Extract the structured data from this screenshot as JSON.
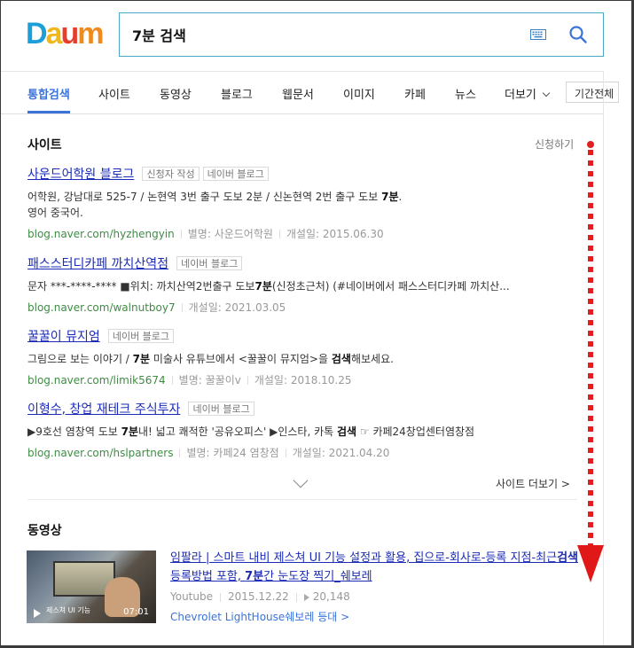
{
  "logo": {
    "text": "Daum",
    "letters": [
      "D",
      "a",
      "u",
      "m"
    ],
    "colors": [
      "#1c9fd8",
      "#f0b71b",
      "#e53e2c",
      "#f08a1c"
    ]
  },
  "search": {
    "query": "7분 검색"
  },
  "tabs": [
    {
      "label": "통합검색",
      "active": true
    },
    {
      "label": "사이트"
    },
    {
      "label": "동영상"
    },
    {
      "label": "블로그"
    },
    {
      "label": "웹문서"
    },
    {
      "label": "이미지"
    },
    {
      "label": "카페"
    },
    {
      "label": "뉴스"
    },
    {
      "label": "더보기"
    }
  ],
  "period_filter": "기간전체",
  "site_section": {
    "title": "사이트",
    "apply_link": "신청하기",
    "results": [
      {
        "title": "사운드어학원 블로그",
        "tags": [
          "신청자 작성",
          "네이버 블로그"
        ],
        "desc_line1": "어학원, 강남대로 525-7 / 논현역 3번 출구 도보 2분 / 신논현역 2번 출구 도보 ",
        "desc_line1_bold": "7분",
        "desc_line1_end": ".",
        "desc_line2": "영어 중국어.",
        "url": "blog.naver.com/hyzhengyin",
        "meta": [
          "별명: 사운드어학원",
          "개설일: 2015.06.30"
        ]
      },
      {
        "title": "패스스터디카페 까치산역점",
        "tags": [
          "네이버 블로그"
        ],
        "desc_pre": "문자 ***-****-**** ■위치: 까치산역2번출구 도보",
        "desc_bold": "7분",
        "desc_post": "(신정초근처) (#네이버에서 패스스터디카페 까치산...",
        "url": "blog.naver.com/walnutboy7",
        "meta": [
          "개설일: 2021.03.05"
        ]
      },
      {
        "title": "꿀꿀이 뮤지엄",
        "tags": [
          "네이버 블로그"
        ],
        "desc_pre": "그림으로 보는 이야기 / ",
        "desc_bold": "7분",
        "desc_mid": " 미술사 유튜브에서 <꿀꿀이 뮤지엄>을 ",
        "desc_bold2": "검색",
        "desc_post": "해보세요.",
        "url": "blog.naver.com/limik5674",
        "meta": [
          "별명: 꿀꿀이v",
          "개설일: 2018.10.25"
        ]
      },
      {
        "title": "이형수, 창업 재테크 주식투자",
        "tags": [
          "네이버 블로그"
        ],
        "desc_pre": "▶9호선 염창역 도보 ",
        "desc_bold": "7분",
        "desc_mid": "내! 넓고 쾌적한 '공유오피스' ▶인스타, 카톡 ",
        "desc_bold2": "검색",
        "desc_post": " ☞ 카페24창업센터염창점",
        "url": "blog.naver.com/hslpartners",
        "meta": [
          "별명: 카페24 염창점",
          "개설일: 2021.04.20"
        ]
      }
    ],
    "more_link": "사이트 더보기 >"
  },
  "video_section": {
    "title": "동영상",
    "video": {
      "duration": "07:01",
      "thumb_caption": "제스쳐 UI 기능",
      "title_a": "임팔라 | 스마트 내비 제스쳐 UI 기능 설정과 활용, 집으로-회사로-등록 지점-최근",
      "title_bold1": "검색",
      "title_b": " 등록방법 포함, ",
      "title_bold2": "7분",
      "title_c": "간 눈도장 찍기_쉐보레",
      "source": "Youtube",
      "date": "2015.12.22",
      "views": "20,148",
      "channel": "Chevrolet LightHouse쉐보레 등대 >"
    }
  }
}
